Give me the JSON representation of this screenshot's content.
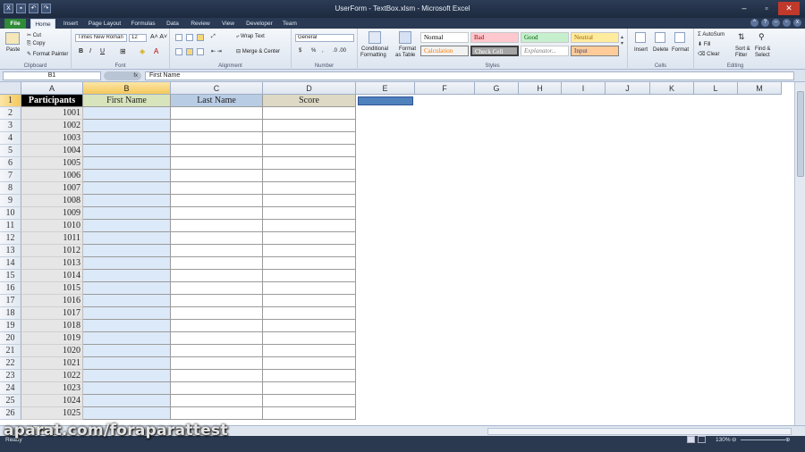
{
  "window": {
    "title": "UserForm - TextBox.xlsm - Microsoft Excel"
  },
  "tabs": [
    "File",
    "Home",
    "Insert",
    "Page Layout",
    "Formulas",
    "Data",
    "Review",
    "View",
    "Developer",
    "Team"
  ],
  "ribbon": {
    "clipboard": {
      "paste": "Paste",
      "cut": "Cut",
      "copy": "Copy",
      "format_painter": "Format Painter",
      "label": "Clipboard"
    },
    "font": {
      "name": "Times New Roman",
      "size": "12",
      "bold": "B",
      "italic": "I",
      "underline": "U",
      "label": "Font"
    },
    "alignment": {
      "wrap": "Wrap Text",
      "merge": "Merge & Center",
      "label": "Alignment"
    },
    "number": {
      "format": "General",
      "currency": "$",
      "percent": "%",
      "comma": ",",
      "label": "Number"
    },
    "styles": {
      "conditional": [
        "Conditional",
        "Formatting"
      ],
      "format_table": [
        "Format",
        "as Table"
      ],
      "cells": [
        "Normal",
        "Bad",
        "Good",
        "Neutral",
        "Calculation",
        "Check Cell",
        "Explanator...",
        "Input"
      ],
      "label": "Styles"
    },
    "cells": {
      "insert": "Insert",
      "delete": "Delete",
      "format": "Format",
      "label": "Cells"
    },
    "editing": {
      "autosum": "AutoSum",
      "fill": "Fill",
      "clear": "Clear",
      "sort": [
        "Sort &",
        "Filter"
      ],
      "find": [
        "Find &",
        "Select"
      ],
      "label": "Editing"
    }
  },
  "formula_bar": {
    "name_box": "B1",
    "fx": "fx",
    "content": "First Name"
  },
  "grid": {
    "columns": [
      "A",
      "B",
      "C",
      "D",
      "E",
      "F",
      "G",
      "H",
      "I",
      "J",
      "K",
      "L",
      "M"
    ],
    "rows": [
      "1",
      "2",
      "3",
      "4",
      "5",
      "6",
      "7",
      "8",
      "9",
      "10",
      "11",
      "12",
      "13",
      "14",
      "15",
      "16",
      "17",
      "18",
      "19",
      "20",
      "21",
      "22",
      "23",
      "24",
      "25",
      "26"
    ],
    "headers": [
      "Participants",
      "First Name",
      "Last Name",
      "Score"
    ],
    "participants": [
      "1001",
      "1002",
      "1003",
      "1004",
      "1005",
      "1006",
      "1007",
      "1008",
      "1009",
      "1010",
      "1011",
      "1012",
      "1013",
      "1014",
      "1015",
      "1016",
      "1017",
      "1018",
      "1019",
      "1020",
      "1021",
      "1022",
      "1023",
      "1024",
      "1025"
    ]
  },
  "sheet_tab": "Data",
  "status": {
    "ready": "Ready",
    "zoom": "130%"
  },
  "watermark": "aparat.com/foraparattest",
  "colors": {
    "header_a": "#000000",
    "header_b": "#d8e4bc",
    "header_c": "#b8cce4",
    "header_d": "#ddd9c4",
    "col_b_fill": "#dce9f8",
    "selected_e": "#4f81bd"
  }
}
